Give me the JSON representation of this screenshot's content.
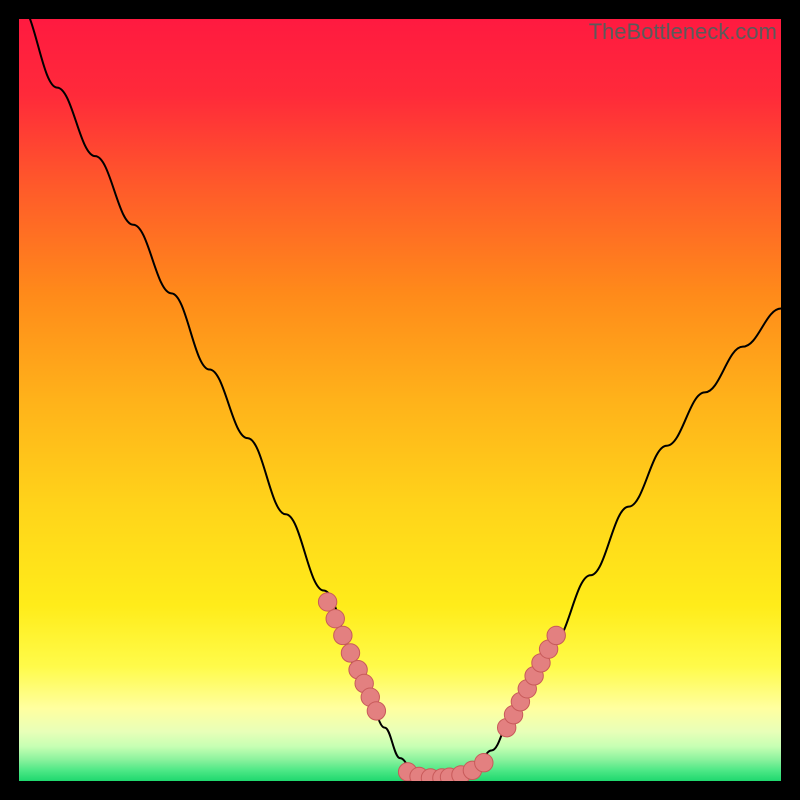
{
  "watermark": "TheBottleneck.com",
  "colors": {
    "top_red": "#ff1a40",
    "mid_orange": "#ffa11a",
    "yellow": "#ffe21a",
    "pale_yellow": "#ffff8a",
    "pale_green": "#c6ffb3",
    "green": "#33e07a",
    "curve": "#000000",
    "marker_fill": "#e38080",
    "marker_stroke": "#c85a5a",
    "frame": "#000000"
  },
  "chart_data": {
    "type": "line",
    "title": "",
    "xlabel": "",
    "ylabel": "",
    "xlim": [
      0,
      100
    ],
    "ylim": [
      0,
      100
    ],
    "x": [
      0,
      5,
      10,
      15,
      20,
      25,
      30,
      35,
      40,
      45,
      48,
      50,
      52,
      54,
      56,
      58,
      60,
      62,
      65,
      70,
      75,
      80,
      85,
      90,
      95,
      100
    ],
    "values": [
      102,
      91,
      82,
      73,
      64,
      54,
      45,
      35,
      25,
      14,
      7,
      3,
      1,
      0,
      0,
      1,
      2,
      4,
      9,
      18,
      27,
      36,
      44,
      51,
      57,
      62
    ],
    "markers_left_descend": {
      "x": [
        40.5,
        41.5,
        42.5,
        43.5,
        44.5,
        45.3,
        46.1,
        46.9
      ],
      "y": [
        23.5,
        21.3,
        19.1,
        16.8,
        14.6,
        12.8,
        11.0,
        9.2
      ]
    },
    "markers_bottom": {
      "x": [
        51.0,
        52.5,
        54.0,
        55.5,
        56.5,
        58.0,
        59.5,
        61.0
      ],
      "y": [
        1.2,
        0.6,
        0.4,
        0.4,
        0.5,
        0.8,
        1.4,
        2.4
      ]
    },
    "markers_right_ascend": {
      "x": [
        64.0,
        64.9,
        65.8,
        66.7,
        67.6,
        68.5,
        69.5,
        70.5
      ],
      "y": [
        7.0,
        8.7,
        10.4,
        12.1,
        13.8,
        15.5,
        17.3,
        19.1
      ]
    }
  }
}
